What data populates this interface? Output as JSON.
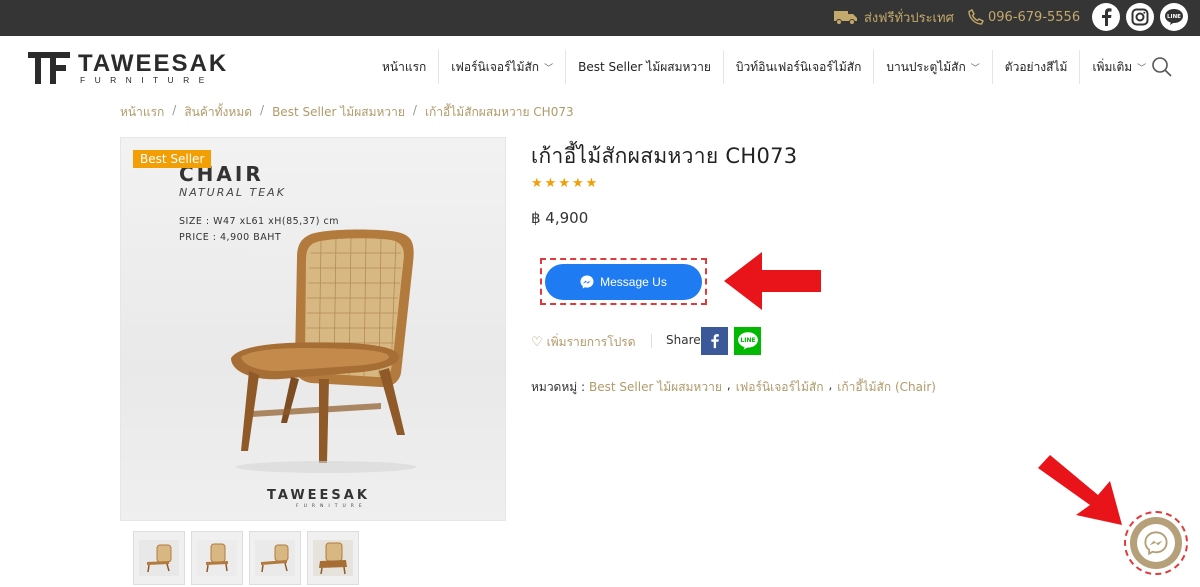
{
  "topbar": {
    "shipping_text": "ส่งฟรีทั่วประเทศ",
    "phone": "096-679-5556",
    "social": [
      "facebook-icon",
      "instagram-icon",
      "line-icon"
    ]
  },
  "logo": {
    "word": "TAWEESAK",
    "sub": "FURNITURE"
  },
  "nav": {
    "items": [
      {
        "label": "หน้าแรก",
        "dropdown": false
      },
      {
        "label": "เฟอร์นิเจอร์ไม้สัก",
        "dropdown": true
      },
      {
        "label": "Best Seller ไม้ผสมหวาย",
        "dropdown": false
      },
      {
        "label": "บิวท์อินเฟอร์นิเจอร์ไม้สัก",
        "dropdown": false
      },
      {
        "label": "บานประตูไม้สัก",
        "dropdown": true
      },
      {
        "label": "ตัวอย่างสีไม้",
        "dropdown": false
      },
      {
        "label": "เพิ่มเติม",
        "dropdown": true
      }
    ]
  },
  "breadcrumb": [
    "หน้าแรก",
    "สินค้าทั้งหมด",
    "Best Seller ไม้ผสมหวาย",
    "เก้าอี้ไม้สักผสมหวาย CH073"
  ],
  "product": {
    "badge": "Best Seller",
    "image_title": "CHAIR",
    "image_subtitle": "NATURAL TEAK",
    "image_size": "SIZE : W47 xL61 xH(85,37) cm",
    "image_price": "PRICE : 4,900 BAHT",
    "image_brand": "TAWEESAK",
    "image_brand_sub": "FURNITURE",
    "title": "เก้าอี้ไม้สักผสมหวาย CH073",
    "rating": 5,
    "price": "฿ 4,900",
    "message_button": "Message Us",
    "wishlist": "เพิ่มรายการโปรด",
    "share_label": "Share",
    "categories_label": "หมวดหมู่ :",
    "categories": [
      "Best Seller ไม้ผสมหวาย",
      "เฟอร์นิเจอร์ไม้สัก",
      "เก้าอี้ไม้สัก (Chair)"
    ],
    "thumbnails": 4
  },
  "colors": {
    "accent_gold": "#b09a6a",
    "badge_orange": "#f29f05",
    "messenger_blue": "#1f7bf2",
    "annotation_red": "#e03a3a",
    "topbar": "#353535"
  }
}
